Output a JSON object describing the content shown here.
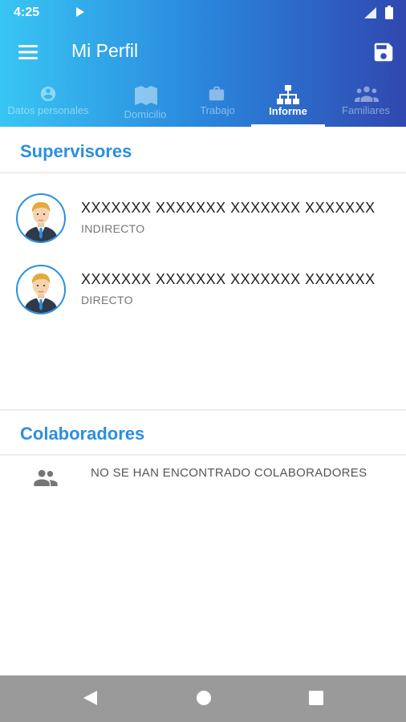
{
  "status_bar": {
    "time": "4:25"
  },
  "app_bar": {
    "title": "Mi Perfil"
  },
  "tabs": [
    {
      "label": "Datos personales",
      "icon": "account-circle-icon"
    },
    {
      "label": "Domicilio",
      "icon": "map-icon"
    },
    {
      "label": "Trabajo",
      "icon": "briefcase-icon"
    },
    {
      "label": "Informe",
      "icon": "org-chart-icon",
      "active": true
    },
    {
      "label": "Familiares",
      "icon": "people-icon"
    }
  ],
  "supervisores": {
    "header": "Supervisores",
    "items": [
      {
        "name": "XXXXXXX XXXXXXX XXXXXXX XXXXXXX",
        "relation": "INDIRECTO"
      },
      {
        "name": "XXXXXXX XXXXXXX XXXXXXX XXXXXXX",
        "relation": "DIRECTO"
      }
    ]
  },
  "colaboradores": {
    "header": "Colaboradores",
    "empty_text": "NO SE HAN ENCONTRADO COLABORADORES"
  },
  "colors": {
    "accent": "#2b8fe0",
    "gradient_start": "#38c6f4",
    "gradient_end": "#3048b0"
  }
}
